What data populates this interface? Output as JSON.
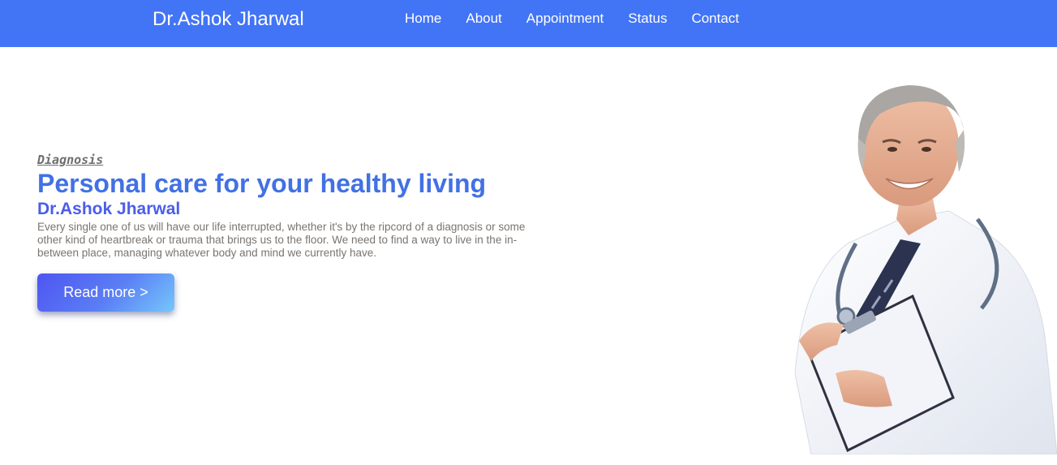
{
  "header": {
    "brand": "Dr.Ashok Jharwal",
    "nav": [
      {
        "label": "Home"
      },
      {
        "label": "About"
      },
      {
        "label": "Appointment"
      },
      {
        "label": "Status"
      },
      {
        "label": "Contact"
      }
    ]
  },
  "hero": {
    "eyebrow": "Diagnosis",
    "headline": "Personal care for your healthy living",
    "doctor_name": "Dr.Ashok Jharwal",
    "description": "Every single one of us will have our life interrupted, whether it's by the ripcord of a diagnosis or some other kind of heartbreak or trauma that brings us to the floor. We need to find a way to live in the in-between place, managing whatever body and mind we currently have.",
    "cta_label": "Read more >"
  },
  "colors": {
    "navbar": "#4274f6",
    "headline": "#4271e4",
    "doctor_name": "#4b5de9",
    "description": "#7a7470"
  },
  "image": {
    "subject": "doctor-photo"
  }
}
